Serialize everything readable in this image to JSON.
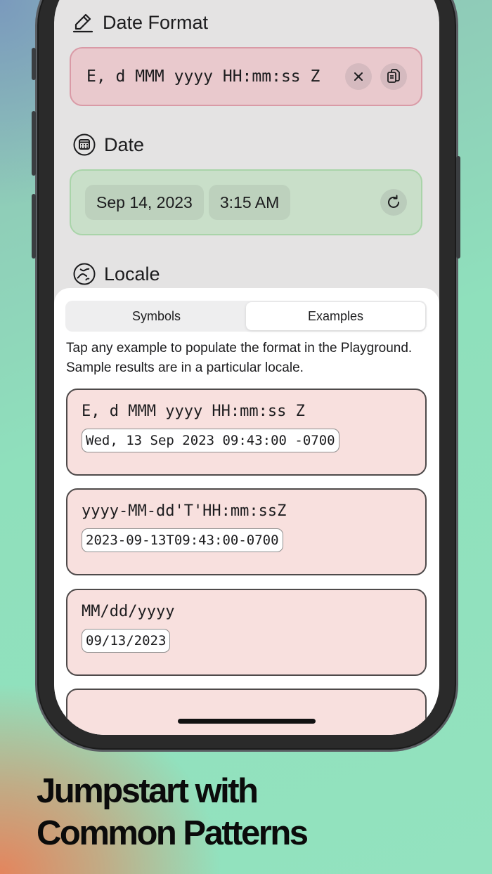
{
  "format_section": {
    "title": "Date Format",
    "icon": "pencil-icon",
    "value": "E, d MMM yyyy HH:mm:ss Z",
    "clear_icon": "close-icon",
    "copy_icon": "copy-icon",
    "accent": "#e9c9cd"
  },
  "date_section": {
    "title": "Date",
    "icon": "calendar-icon",
    "date": "Sep 14, 2023",
    "time": "3:15 AM",
    "reset_icon": "refresh-icon",
    "accent": "#c9dfc9"
  },
  "locale_section": {
    "title": "Locale",
    "icon": "globe-icon"
  },
  "sheet": {
    "tabs": [
      {
        "label": "Symbols",
        "active": false
      },
      {
        "label": "Examples",
        "active": true
      }
    ],
    "description_line1": "Tap any example to populate the format in the Playground.",
    "description_line2": "Sample results are in a particular locale.",
    "examples": [
      {
        "pattern": "E, d MMM yyyy HH:mm:ss Z",
        "result": "Wed, 13 Sep 2023 09:43:00 -0700"
      },
      {
        "pattern": "yyyy-MM-dd'T'HH:mm:ssZ",
        "result": "2023-09-13T09:43:00-0700"
      },
      {
        "pattern": "MM/dd/yyyy",
        "result": "09/13/2023"
      }
    ]
  },
  "headline": {
    "line1": "Jumpstart with",
    "line2": "Common Patterns"
  }
}
